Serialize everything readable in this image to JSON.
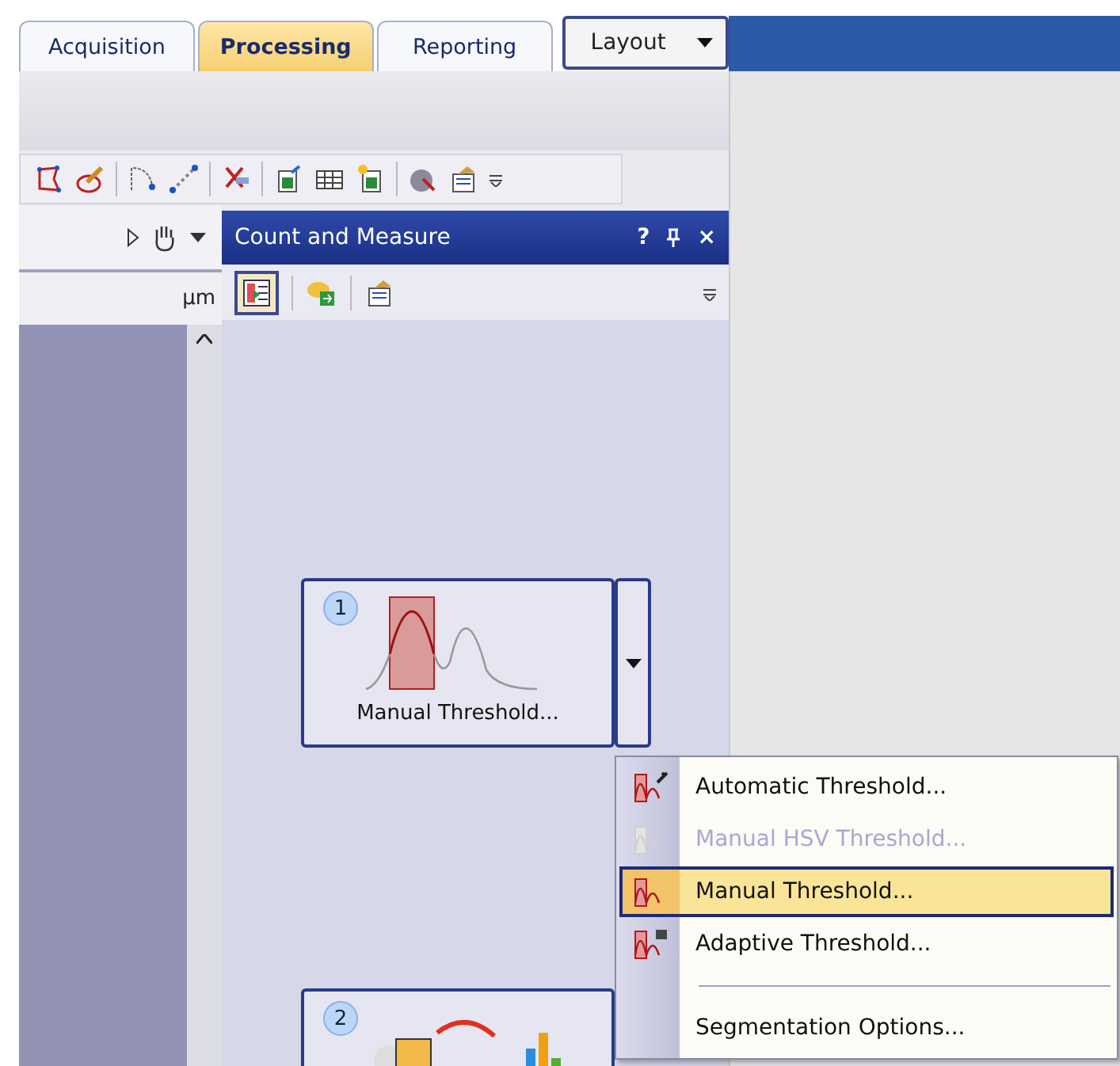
{
  "tabs": [
    {
      "label": "Acquisition",
      "selected": false
    },
    {
      "label": "Processing",
      "selected": true
    },
    {
      "label": "Reporting",
      "selected": false
    }
  ],
  "layout_button": {
    "label": "Layout"
  },
  "image_panel": {
    "unit": "µm"
  },
  "panel": {
    "title": "Count and Measure",
    "help": "?",
    "close": "×"
  },
  "steps": [
    {
      "number": "1",
      "label": "Manual Threshold...",
      "kind": "threshold"
    },
    {
      "number": "2",
      "kind": "measure"
    }
  ],
  "menu": {
    "items": [
      {
        "kind": "item",
        "label": "Automatic Threshold...",
        "disabled": false,
        "selected": false
      },
      {
        "kind": "item",
        "label": "Manual HSV Threshold...",
        "disabled": true,
        "selected": false
      },
      {
        "kind": "item",
        "label": "Manual Threshold...",
        "disabled": false,
        "selected": true
      },
      {
        "kind": "item",
        "label": "Adaptive Threshold...",
        "disabled": false,
        "selected": false
      },
      {
        "kind": "separator"
      },
      {
        "kind": "item",
        "label": "Segmentation Options...",
        "disabled": false,
        "selected": false
      }
    ]
  }
}
